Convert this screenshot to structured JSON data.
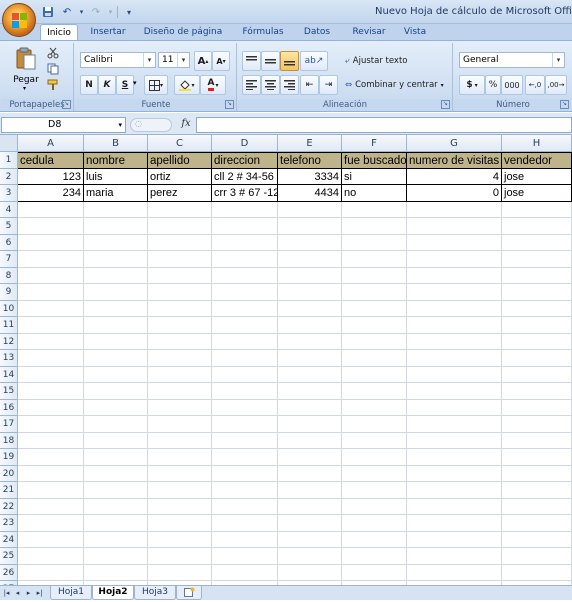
{
  "window": {
    "title": "Nuevo Hoja de cálculo de Microsoft Office Ex"
  },
  "colors": {
    "header_fill": "#bfb38c",
    "ribbon": "#dbe6f4",
    "accent": "#15428b"
  },
  "quick_access": {
    "icons": [
      "save-icon",
      "undo-icon",
      "redo-icon",
      "customize-icon"
    ]
  },
  "ribbon_tabs": [
    {
      "label": "Inicio",
      "active": true
    },
    {
      "label": "Insertar"
    },
    {
      "label": "Diseño de página"
    },
    {
      "label": "Fórmulas"
    },
    {
      "label": "Datos"
    },
    {
      "label": "Revisar"
    },
    {
      "label": "Vista"
    }
  ],
  "clipboard": {
    "paste_label": "Pegar",
    "group_label": "Portapapeles"
  },
  "font": {
    "name": "Calibri",
    "size": "11",
    "bold": "N",
    "italic": "K",
    "underline": "S",
    "font_color_glyph": "A",
    "group_label": "Fuente"
  },
  "alignment": {
    "wrap_text": "Ajustar texto",
    "merge_center": "Combinar y centrar",
    "group_label": "Alineación"
  },
  "number": {
    "format": "General",
    "currency": "$",
    "percent": "%",
    "thousands": "000",
    "group_label": "Número"
  },
  "formula_bar": {
    "name_box": "D8",
    "fx_label": "fx",
    "formula": ""
  },
  "sheet": {
    "columns": [
      "A",
      "B",
      "C",
      "D",
      "E",
      "F",
      "G",
      "H"
    ],
    "rows": [
      "1",
      "2",
      "3",
      "4",
      "5",
      "6",
      "7",
      "8",
      "9",
      "10",
      "11",
      "12",
      "13",
      "14",
      "15",
      "16",
      "17",
      "18",
      "19",
      "20",
      "21",
      "22",
      "23",
      "24",
      "25",
      "26",
      "27"
    ],
    "header": [
      "cedula",
      "nombre",
      "apellido",
      "direccion",
      "telefono",
      "fue buscado",
      "numero de visitas",
      "vendedor"
    ],
    "data": [
      [
        "123",
        "luis",
        "ortiz",
        "cll 2 # 34-56",
        "3334",
        "si",
        "4",
        "jose"
      ],
      [
        "234",
        "maria",
        "perez",
        "crr 3 # 67 -12",
        "4434",
        "no",
        "0",
        "jose"
      ]
    ]
  },
  "sheet_tabs": [
    {
      "label": "Hoja1"
    },
    {
      "label": "Hoja2",
      "active": true
    },
    {
      "label": "Hoja3"
    }
  ]
}
